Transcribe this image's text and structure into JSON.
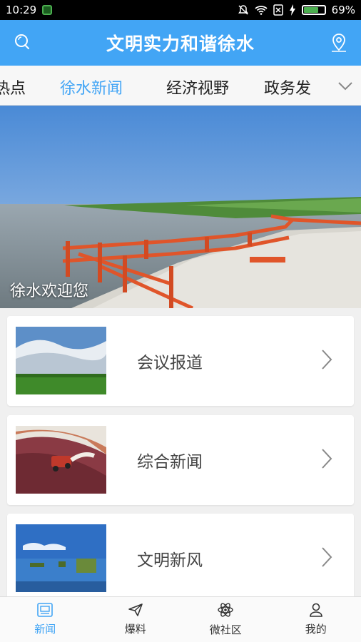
{
  "status_bar": {
    "time": "10:29",
    "battery": "69%"
  },
  "app_bar": {
    "title": "文明实力和谐徐水",
    "left_icon": "search-icon",
    "right_icon": "location-icon"
  },
  "tabs": [
    {
      "label": "热点"
    },
    {
      "label": "徐水新闻",
      "active": true
    },
    {
      "label": "经济视野"
    },
    {
      "label": "政务发"
    }
  ],
  "hero": {
    "caption": "徐水欢迎您"
  },
  "cards": [
    {
      "label": "会议报道"
    },
    {
      "label": "综合新闻"
    },
    {
      "label": "文明新风"
    }
  ],
  "bottom_nav": [
    {
      "label": "新闻",
      "icon": "news-icon",
      "active": true
    },
    {
      "label": "爆料",
      "icon": "send-icon"
    },
    {
      "label": "微社区",
      "icon": "atom-icon"
    },
    {
      "label": "我的",
      "icon": "user-icon"
    }
  ],
  "colors": {
    "accent": "#42a5f5",
    "status_bar": "#000000",
    "background": "#f0f0f0"
  }
}
